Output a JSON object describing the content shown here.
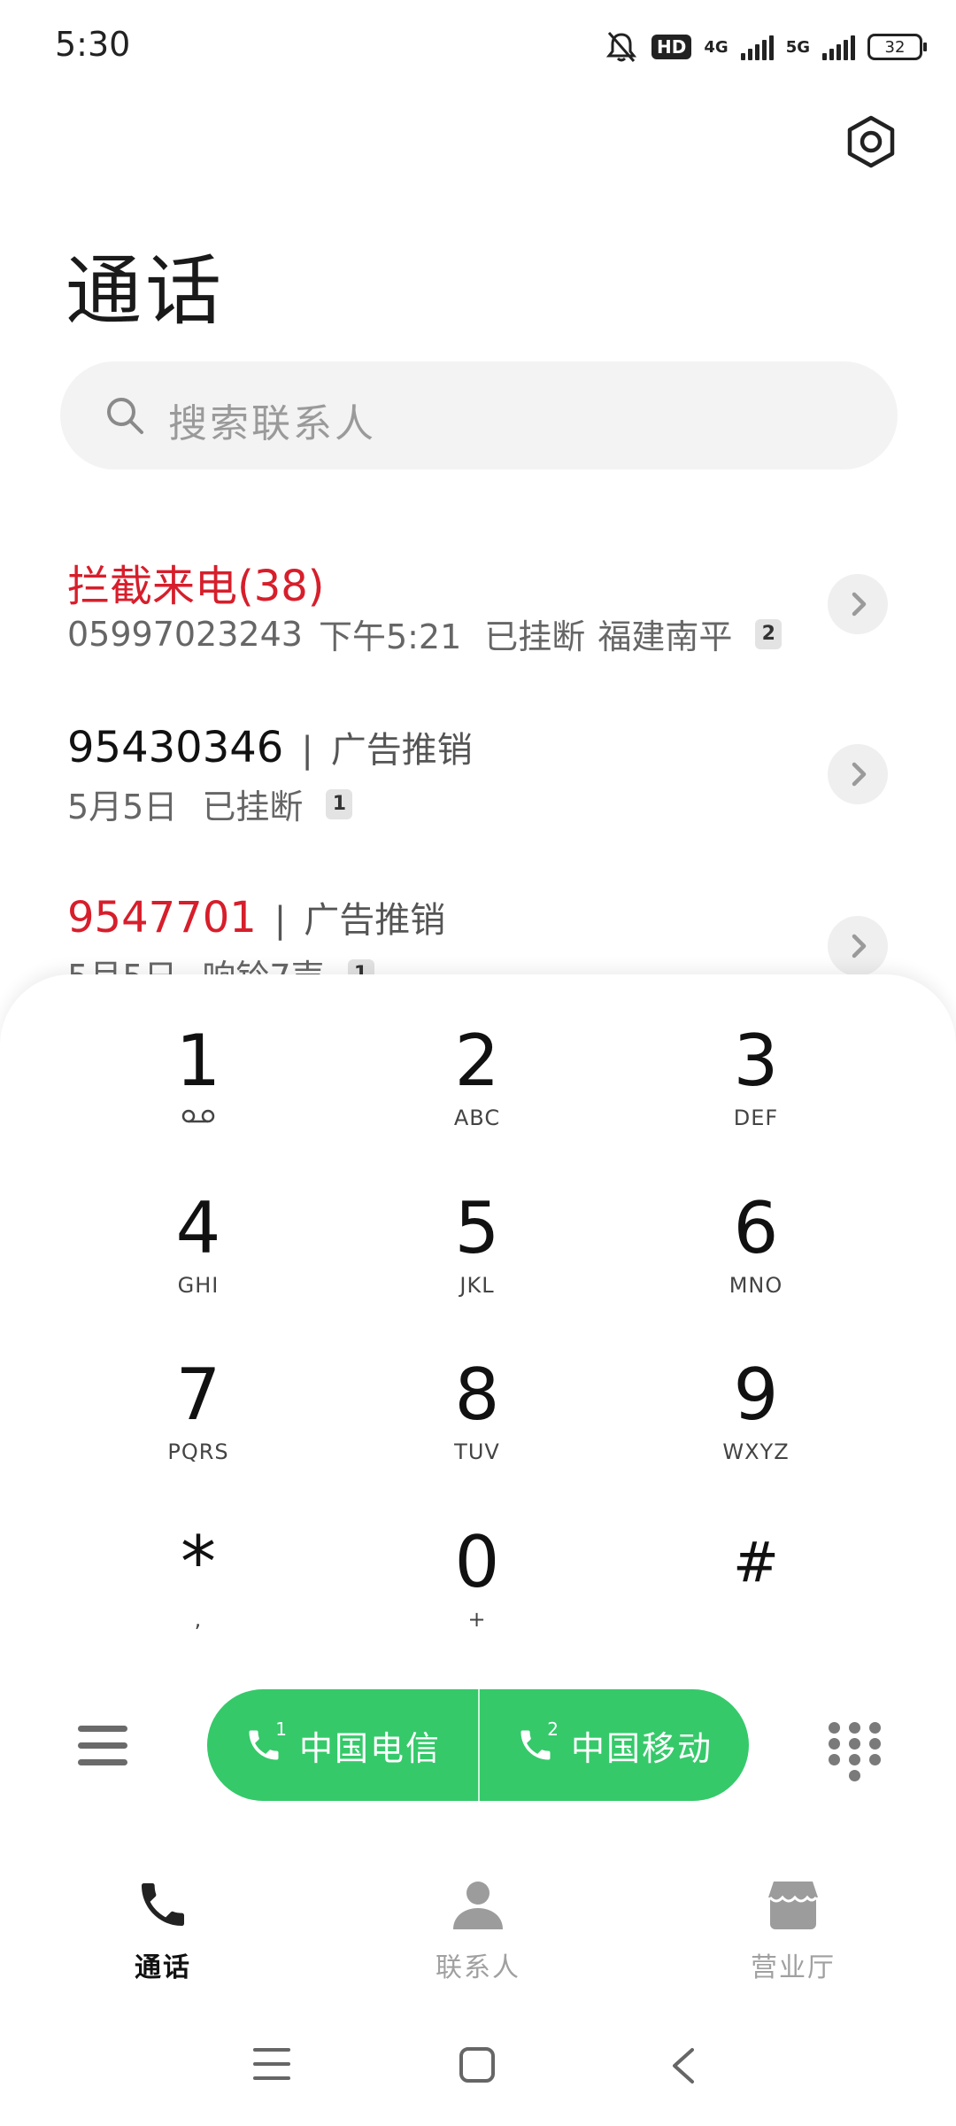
{
  "status_bar": {
    "time": "5:30",
    "network_1": "4G",
    "network_2": "5G",
    "hd_label": "HD",
    "battery": "32"
  },
  "header": {
    "title": "通话"
  },
  "search": {
    "placeholder": "搜索联系人"
  },
  "call_log": [
    {
      "name": "拦截来电(38)",
      "name_color": "#d71e2b",
      "tag": "",
      "number": "05997023243",
      "time": "下午5:21",
      "status": "已挂断",
      "location": "福建南平",
      "count": "2"
    },
    {
      "name": "95430346",
      "name_color": "#111111",
      "tag": "广告推销",
      "time": "5月5日",
      "status": "已挂断",
      "count": "1"
    },
    {
      "name": "9547701",
      "name_color": "#d71e2b",
      "tag": "广告推销",
      "time": "5月5日",
      "status": "响铃7声",
      "count": "1"
    }
  ],
  "dialpad": {
    "keys": [
      {
        "digit": "1",
        "letters": ""
      },
      {
        "digit": "2",
        "letters": "ABC"
      },
      {
        "digit": "3",
        "letters": "DEF"
      },
      {
        "digit": "4",
        "letters": "GHI"
      },
      {
        "digit": "5",
        "letters": "JKL"
      },
      {
        "digit": "6",
        "letters": "MNO"
      },
      {
        "digit": "7",
        "letters": "PQRS"
      },
      {
        "digit": "8",
        "letters": "TUV"
      },
      {
        "digit": "9",
        "letters": "WXYZ"
      },
      {
        "digit": "*",
        "letters": ","
      },
      {
        "digit": "0",
        "letters": "+"
      },
      {
        "digit": "#",
        "letters": ""
      }
    ]
  },
  "call_buttons": {
    "sim1_label": "中国电信",
    "sim1_index": "1",
    "sim2_label": "中国移动",
    "sim2_index": "2",
    "color": "#35c96a"
  },
  "tabs": [
    {
      "label": "通话",
      "icon": "phone-icon",
      "active": true
    },
    {
      "label": "联系人",
      "icon": "person-icon",
      "active": false
    },
    {
      "label": "营业厅",
      "icon": "store-icon",
      "active": false
    }
  ]
}
